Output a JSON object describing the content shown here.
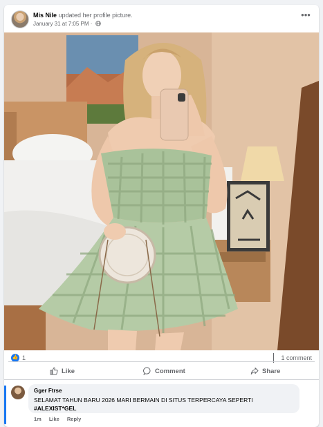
{
  "post": {
    "author_name": "Mis Nile",
    "action_text": "updated her profile picture.",
    "timestamp": "January 31 at 7:05 PM",
    "separator": "·",
    "more_icon": "more-horizontal-icon",
    "audience_icon": "globe-icon"
  },
  "reactions": {
    "count": "1",
    "comments_label": "1 comment",
    "icon": "like-reaction-icon"
  },
  "actions": {
    "like_label": "Like",
    "comment_label": "Comment",
    "share_label": "Share"
  },
  "comment": {
    "author": "Gger Ftrse",
    "text": "SELAMAT TAHUN BARU 2026 MARI BERMAIN DI SITUS TERPERCAYA SEPERTI",
    "mention": "#ALEXIST*GEL",
    "time": "1m",
    "like_label": "Like",
    "reply_label": "Reply"
  },
  "colors": {
    "accent": "#1877f2",
    "secondary_text": "#65676b",
    "dress": "#a9c29a"
  }
}
